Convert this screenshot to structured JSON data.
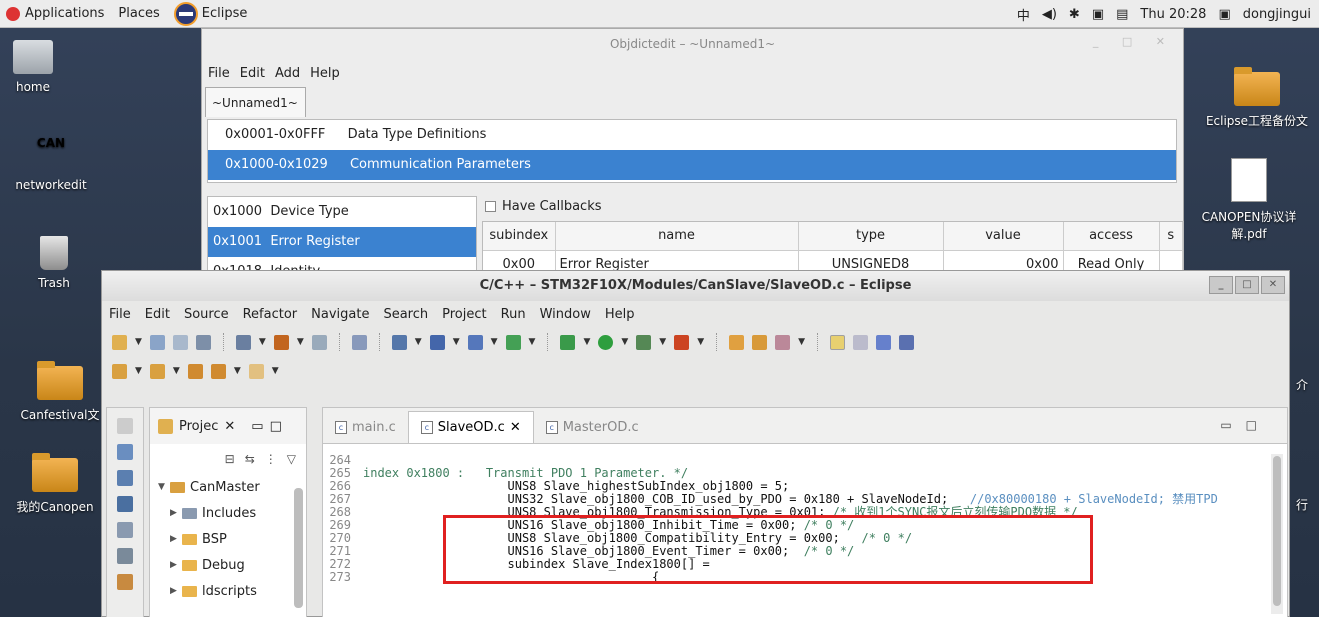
{
  "top_panel": {
    "applications": "Applications",
    "places": "Places",
    "taskbar_app": "Eclipse",
    "input_method": "中",
    "clock": "Thu 20:28",
    "user": "dongjingui"
  },
  "desktop": {
    "icons": [
      {
        "label": "home"
      },
      {
        "label": "networkedit"
      },
      {
        "label": "Trash"
      },
      {
        "label": "Canfestival文"
      },
      {
        "label": "我的Canopen"
      },
      {
        "label": "Eclipse工程备份文"
      },
      {
        "label": "CANOPEN协议详解.pdf"
      },
      {
        "label": "介"
      },
      {
        "label": "行"
      }
    ]
  },
  "objdictedit": {
    "title": "Objdictedit – ~Unnamed1~",
    "menu": [
      "File",
      "Edit",
      "Add",
      "Help"
    ],
    "doc_tab": "~Unnamed1~",
    "ranges": [
      {
        "code": "0x0001-0x0FFF",
        "label": "Data Type Definitions"
      },
      {
        "code": "0x1000-0x1029",
        "label": "Communication Parameters"
      }
    ],
    "indexes": [
      {
        "code": "0x1000",
        "label": "Device Type"
      },
      {
        "code": "0x1001",
        "label": "Error Register"
      },
      {
        "code": "0x1018",
        "label": "Identity"
      }
    ],
    "have_callbacks": "Have Callbacks",
    "grid": {
      "columns": [
        "subindex",
        "name",
        "type",
        "value",
        "access",
        "s"
      ],
      "rows": [
        {
          "subindex": "0x00",
          "name": "Error Register",
          "type": "UNSIGNED8",
          "value": "0x00",
          "access": "Read Only"
        }
      ]
    }
  },
  "eclipse": {
    "title": "C/C++ – STM32F10X/Modules/CanSlave/SlaveOD.c – Eclipse",
    "menu": [
      "File",
      "Edit",
      "Source",
      "Refactor",
      "Navigate",
      "Search",
      "Project",
      "Run",
      "Window",
      "Help"
    ],
    "project_view": {
      "tab_label": "Projec",
      "tree": [
        {
          "label": "CanMaster",
          "level": 0,
          "expanded": true
        },
        {
          "label": "Includes",
          "level": 1
        },
        {
          "label": "BSP",
          "level": 1
        },
        {
          "label": "Debug",
          "level": 1
        },
        {
          "label": "ldscripts",
          "level": 1
        }
      ]
    },
    "editor": {
      "tabs": [
        {
          "label": "main.c",
          "active": false
        },
        {
          "label": "SlaveOD.c",
          "active": true
        },
        {
          "label": "MasterOD.c",
          "active": false
        }
      ],
      "lines": [
        {
          "n": "264",
          "code": "",
          "comment": ""
        },
        {
          "n": "265",
          "code": "index 0x1800 :   ",
          "comment": "Transmit PDO 1 Parameter. */"
        },
        {
          "n": "266",
          "code": "                    UNS8 Slave_highestSubIndex_obj1800 = 5;",
          "comment": ""
        },
        {
          "n": "267",
          "code": "                    UNS32 Slave_obj1800_COB_ID_used_by_PDO = 0x180 + SlaveNodeId;   ",
          "comment": "//0x80000180 + SlaveNodeId; 禁用TPD"
        },
        {
          "n": "268",
          "code": "                    UNS8 Slave_obj1800_Transmission_Type = 0x01; ",
          "comment": "/* 收到1个SYNC报文后立刻传输PDO数据 */"
        },
        {
          "n": "269",
          "code": "                    UNS16 Slave_obj1800_Inhibit_Time = 0x00; ",
          "comment": "/* 0 */"
        },
        {
          "n": "270",
          "code": "                    UNS8 Slave_obj1800_Compatibility_Entry = 0x00;   ",
          "comment": "/* 0 */"
        },
        {
          "n": "271",
          "code": "                    UNS16 Slave_obj1800_Event_Timer = 0x00;  ",
          "comment": "/* 0 */"
        },
        {
          "n": "272",
          "code": "                    subindex Slave_Index1800[] =",
          "comment": ""
        },
        {
          "n": "273",
          "code": "                                        {",
          "comment": ""
        }
      ]
    }
  },
  "colors": {
    "selection": "#3b82d0",
    "highlight_box": "#e02020",
    "comment": "#3f7f5f"
  }
}
